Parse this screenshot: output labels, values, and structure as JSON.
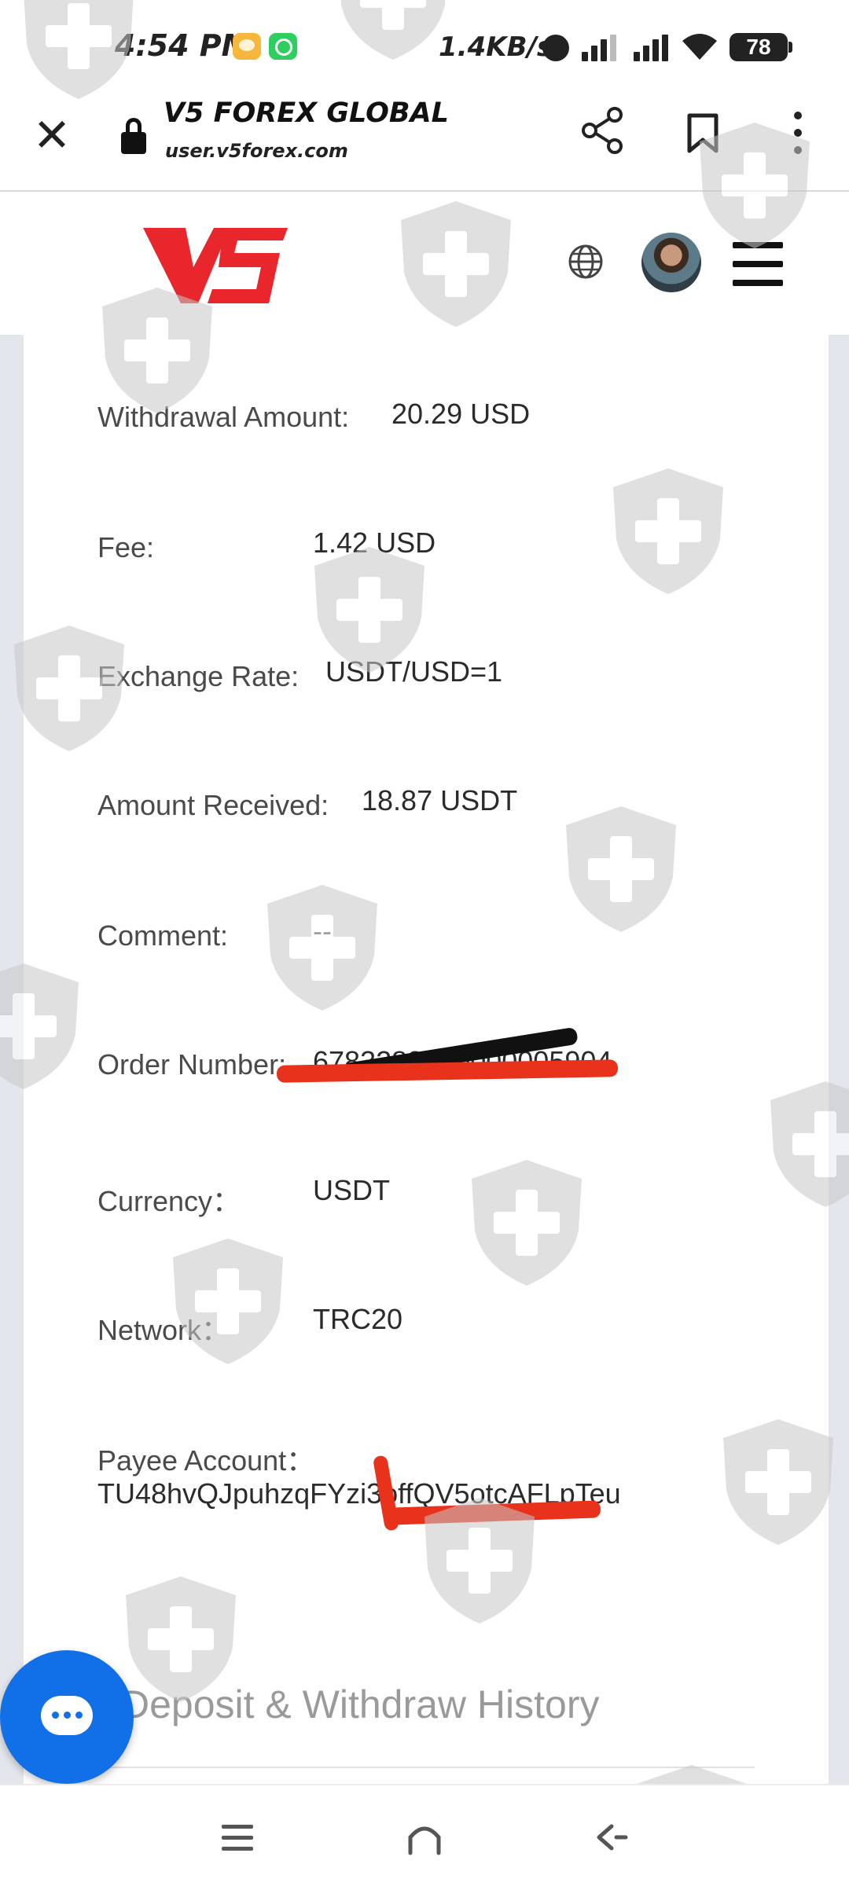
{
  "status_bar": {
    "time": "4:54 PM",
    "net_speed": "1.4KB/s",
    "battery": "78",
    "icons": [
      "message-notification-icon",
      "whatsapp-icon",
      "alarm-icon",
      "signal-icon",
      "signal-icon",
      "wifi-icon",
      "battery-icon"
    ]
  },
  "browser": {
    "title": "V5 FOREX GLOBAL",
    "url": "user.v5forex.com",
    "close_glyph": "✕"
  },
  "header": {
    "logo": "V5",
    "logo_color": "#e8262b"
  },
  "details": [
    {
      "label": "Withdrawal Amount:",
      "value": "20.29 USD"
    },
    {
      "label": "Fee:",
      "value": "1.42 USD"
    },
    {
      "label": "Exchange Rate:",
      "value": "USDT/USD=1"
    },
    {
      "label": "Amount Received:",
      "value": "18.87 USDT"
    },
    {
      "label": "Comment:",
      "value": "--"
    },
    {
      "label": "Order Number:",
      "value": "6783283300000005904"
    },
    {
      "label": "Currency：",
      "value": "USDT"
    },
    {
      "label": "Network：",
      "value": "TRC20"
    },
    {
      "label": "Payee Account：",
      "value": "TU48hvQJpuhzqFYzi3offQV5otcAFLpTeu"
    }
  ],
  "history": {
    "title": "Deposit & Withdraw History"
  },
  "colors": {
    "accent": "#1170e8",
    "redaction_red": "#e8321c",
    "redaction_black": "#111111"
  }
}
